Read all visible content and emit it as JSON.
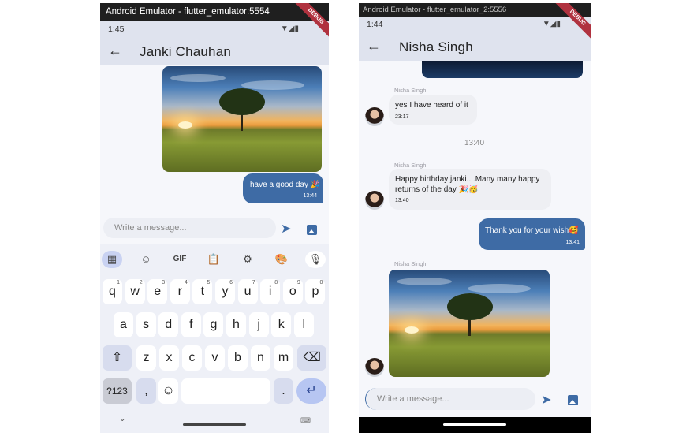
{
  "left": {
    "window_title": "Android Emulator - flutter_emulator:5554",
    "status_time": "1:45",
    "debug_label": "DEBUG",
    "chat_name": "Janki Chauhan",
    "messages": [
      {
        "type": "image",
        "direction": "outgoing"
      },
      {
        "type": "text",
        "direction": "outgoing",
        "text": "have a good day 🎉",
        "time": "13:44"
      }
    ],
    "input_placeholder": "Write a message...",
    "keyboard": {
      "row1": [
        {
          "k": "q",
          "h": "1"
        },
        {
          "k": "w",
          "h": "2"
        },
        {
          "k": "e",
          "h": "3"
        },
        {
          "k": "r",
          "h": "4"
        },
        {
          "k": "t",
          "h": "5"
        },
        {
          "k": "y",
          "h": "6"
        },
        {
          "k": "u",
          "h": "7"
        },
        {
          "k": "i",
          "h": "8"
        },
        {
          "k": "o",
          "h": "9"
        },
        {
          "k": "p",
          "h": "0"
        }
      ],
      "row2": [
        "a",
        "s",
        "d",
        "f",
        "g",
        "h",
        "j",
        "k",
        "l"
      ],
      "row3": [
        "z",
        "x",
        "c",
        "v",
        "b",
        "n",
        "m"
      ],
      "symbols_label": "?123",
      "comma": ",",
      "period": ".",
      "gif_label": "GIF"
    }
  },
  "right": {
    "window_title": "Android Emulator - flutter_emulator_2:5556",
    "status_time": "1:44",
    "debug_label": "DEBUG",
    "chat_name": "Nisha Singh",
    "messages": [
      {
        "type": "text",
        "direction": "incoming",
        "sender": "Nisha Singh",
        "text": "yes I have heard of it",
        "time": "23:17"
      },
      {
        "type": "timestamp",
        "text": "13:40"
      },
      {
        "type": "text",
        "direction": "incoming",
        "sender": "Nisha Singh",
        "text_line1": "Happy birthday janki....Many many happy",
        "text_line2": "returns of the day 🎉🥳",
        "time": "13:40"
      },
      {
        "type": "text",
        "direction": "outgoing",
        "text": "Thank you for your wish🥰",
        "time": "13:41"
      },
      {
        "type": "image",
        "direction": "incoming",
        "sender": "Nisha Singh"
      }
    ],
    "input_placeholder": "Write a message..."
  },
  "colors": {
    "accent": "#3e6ba5",
    "app_bar": "#dfe3ee",
    "incoming_bubble": "#eeeff3",
    "debug_ribbon": "#b0323f"
  }
}
